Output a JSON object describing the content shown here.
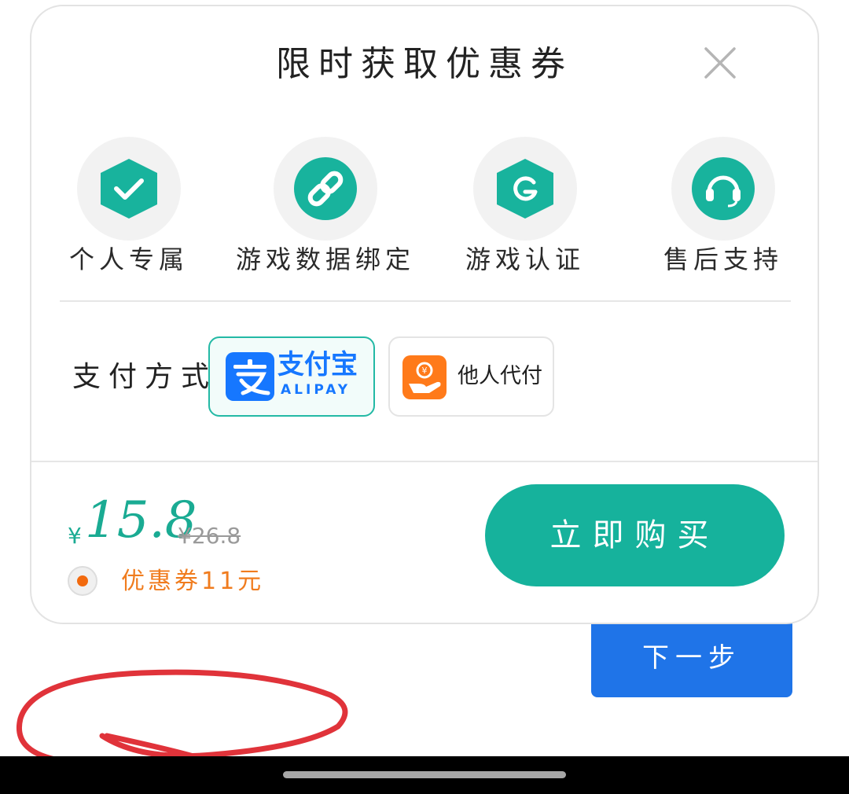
{
  "dialog": {
    "title": "限时获取优惠券",
    "features": [
      {
        "label": "个人专属",
        "icon": "shield-check-icon"
      },
      {
        "label": "游戏数据绑定",
        "icon": "link-icon"
      },
      {
        "label": "游戏认证",
        "icon": "g-badge-icon"
      },
      {
        "label": "售后支持",
        "icon": "headset-icon"
      }
    ],
    "payment": {
      "label": "支付方式",
      "options": [
        {
          "name": "支付宝",
          "subtitle": "ALIPAY",
          "icon": "alipay-icon",
          "selected": true
        },
        {
          "name": "他人代付",
          "icon": "pay-for-me-icon",
          "selected": false
        }
      ]
    },
    "price": {
      "currency": "¥",
      "amount": "15.8",
      "original": "¥26.8"
    },
    "coupon": {
      "text": "优惠券11元",
      "checked": true
    },
    "buy_label": "立即购买"
  },
  "background": {
    "next_label": "下一步"
  },
  "colors": {
    "accent": "#16b29c",
    "price": "#1aab93",
    "coupon": "#f07c1e",
    "alipay_blue": "#1677ff",
    "next_button": "#1f74e8",
    "annotation_red": "#e0333a"
  }
}
